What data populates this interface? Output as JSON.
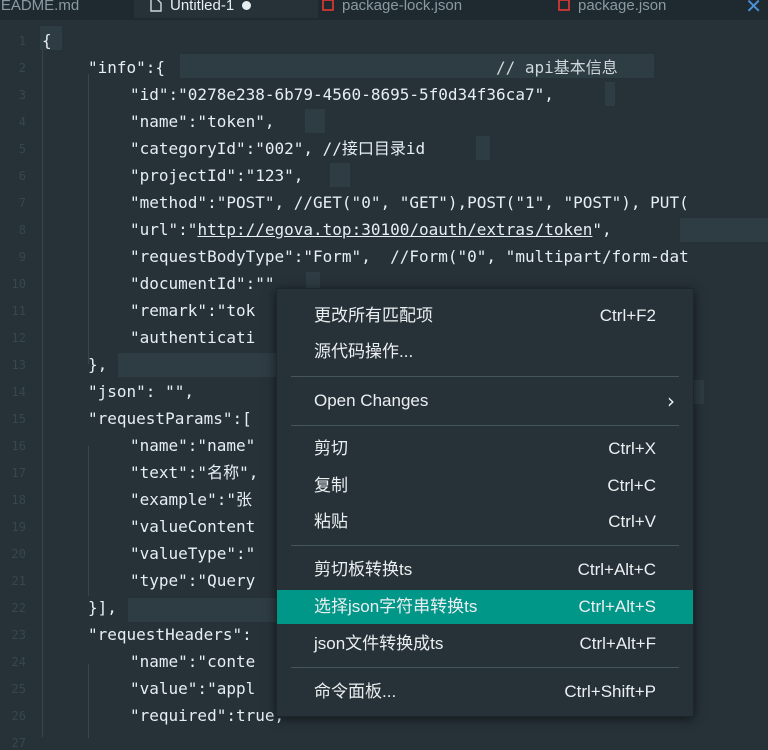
{
  "tabs": [
    {
      "label": "README.md"
    },
    {
      "label": "Untitled-1",
      "active": true,
      "dirty": true
    },
    {
      "label": "package-lock.json"
    },
    {
      "label": "package.json"
    }
  ],
  "gutter": {
    "lines": [
      "1",
      "2",
      "3",
      "4",
      "5",
      "6",
      "7",
      "8",
      "9",
      "10",
      "11",
      "12",
      "13",
      "14",
      "15",
      "16",
      "17",
      "18",
      "19",
      "20",
      "21",
      "22",
      "23",
      "24",
      "25",
      "26",
      "27"
    ]
  },
  "code": {
    "l1": "{",
    "l2_key": "\"info\"",
    "l2_rest": ":{",
    "l2_comment": "// api基本信息",
    "l3": "\"id\":\"0278e238-6b79-4560-8695-5f0d34f36ca7\",",
    "l4": "\"name\":\"token\",",
    "l5": "\"categoryId\":\"002\", //接口目录id",
    "l6": "\"projectId\":\"123\",",
    "l7": "\"method\":\"POST\", //GET(\"0\", \"GET\"),POST(\"1\", \"POST\"), PUT(",
    "l8_a": "\"url\":\"",
    "l8_url": "http://egova.top:30100/oauth/extras/token",
    "l8_b": "\",",
    "l9": "\"requestBodyType\":\"Form\",  //Form(\"0\", \"multipart/form-dat",
    "l10": "\"documentId\":\"\"",
    "l11": "\"remark\":\"tok",
    "l12": "\"authenticati",
    "l13": "},",
    "l14": "\"json\": \"\",",
    "l15": "\"requestParams\":[",
    "l16": "\"name\":\"name\"",
    "l17": "\"text\":\"名称\",",
    "l18": "\"example\":\"张",
    "l19": "\"valueContent",
    "l20": "\"valueType\":\"",
    "l21": "\"type\":\"Query",
    "l22": "}],",
    "l23": "\"requestHeaders\":",
    "l24": "\"name\":\"conte",
    "l25": "\"value\":\"appl",
    "l26": "\"required\":true,"
  },
  "menu": {
    "items": [
      {
        "label": "更改所有匹配项",
        "shortcut": "Ctrl+F2"
      },
      {
        "label": "源代码操作...",
        "shortcut": ""
      },
      {
        "label": "Open Changes",
        "shortcut": "",
        "submenu": true
      },
      {
        "label": "剪切",
        "shortcut": "Ctrl+X"
      },
      {
        "label": "复制",
        "shortcut": "Ctrl+C"
      },
      {
        "label": "粘贴",
        "shortcut": "Ctrl+V"
      },
      {
        "label": "剪切板转换ts",
        "shortcut": "Ctrl+Alt+C"
      },
      {
        "label": "选择json字符串转换ts",
        "shortcut": "Ctrl+Alt+S",
        "selected": true
      },
      {
        "label": "json文件转换成ts",
        "shortcut": "Ctrl+Alt+F"
      },
      {
        "label": "命令面板...",
        "shortcut": "Ctrl+Shift+P"
      }
    ]
  },
  "colors": {
    "background": "#263238",
    "menu_highlight": "#009688",
    "text": "#e6eef2"
  }
}
